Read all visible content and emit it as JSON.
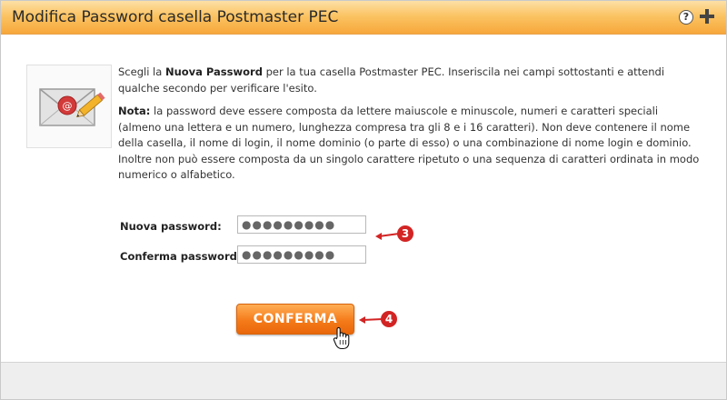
{
  "header": {
    "title": "Modifica Password casella Postmaster PEC"
  },
  "intro": {
    "p1_pre": "Scegli la ",
    "p1_bold": "Nuova Password",
    "p1_post": " per la tua casella Postmaster PEC. Inseriscila nei campi sottostanti e attendi qualche secondo per verificare l'esito.",
    "note_bold": "Nota:",
    "note_text": " la password deve essere composta da lettere maiuscole e minuscole, numeri e caratteri speciali (almeno una lettera e un numero, lunghezza compresa tra gli 8 e i 16 caratteri). Non deve contenere il nome della casella, il nome di login, il nome dominio (o parte di esso) o una combinazione di nome login e dominio. Inoltre non può essere composta da un singolo carattere ripetuto o una sequenza di caratteri ordinata in modo numerico o alfabetico."
  },
  "form": {
    "new_label": "Nuova password:",
    "new_value": "●●●●●●●●●",
    "confirm_label": "Conferma password:",
    "confirm_value": "●●●●●●●●●"
  },
  "buttons": {
    "confirm_label": "CONFERMA"
  },
  "callouts": {
    "step3": "3",
    "step4": "4"
  },
  "colors": {
    "accent": "#f57b1a",
    "callout": "#d32424",
    "header": "#fbc464"
  },
  "icons": [
    "help-icon",
    "plus-icon",
    "envelope-email-icon",
    "hand-cursor-icon"
  ]
}
